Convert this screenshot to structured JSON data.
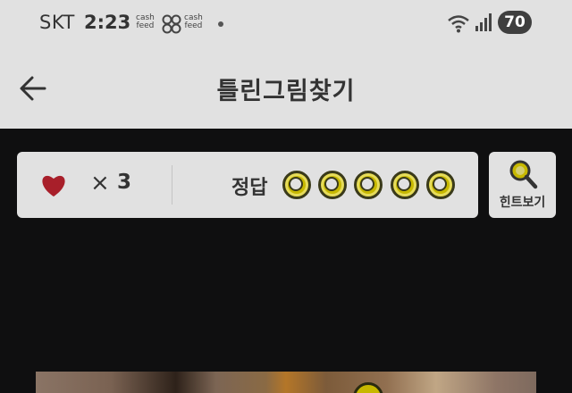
{
  "status_bar": {
    "carrier": "SKT",
    "time": "2:23",
    "app_logo_1": [
      "cash",
      "feed"
    ],
    "app_logo_2": [
      "cash",
      "feed"
    ],
    "battery": "70",
    "icons": [
      "clover-icon",
      "notification-dot-icon",
      "wifi-icon",
      "signal-icon",
      "battery-icon"
    ]
  },
  "header": {
    "title": "틀린그림찾기",
    "back_icon": "arrow-left-icon"
  },
  "game_status": {
    "lives_icon": "heart-icon",
    "lives_symbol": "×",
    "lives": "3",
    "answer_label": "정답",
    "answers_total": 5,
    "answers_found": 0,
    "heart_color": "#a81f2a",
    "slot_color": "#c7b800"
  },
  "hint_button": {
    "label": "힌트보기",
    "icon": "magnifier-icon"
  },
  "puzzle": {
    "image": "food-photo"
  }
}
